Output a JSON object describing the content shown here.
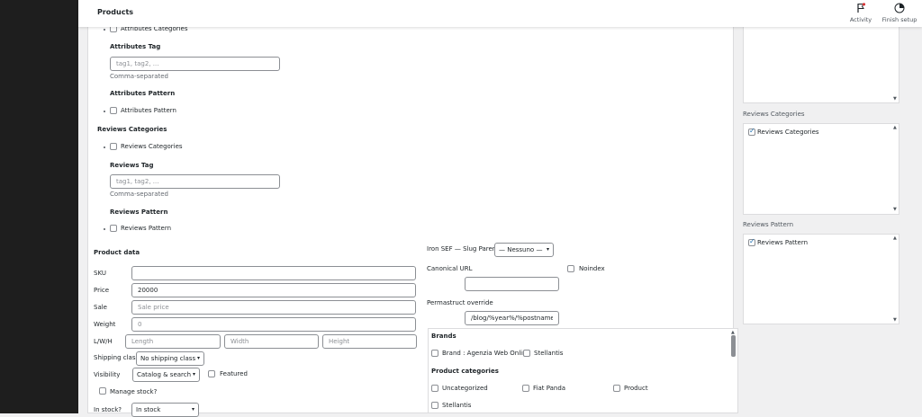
{
  "header": {
    "title": "Products",
    "activity_label": "Activity",
    "finish_setup_label": "Finish setup"
  },
  "left": {
    "attr_categories": "Attributes Categories",
    "attr_tag_title": "Attributes Tag",
    "attr_tag_placeholder": "tag1, tag2, ...",
    "attr_tag_hint": "Comma-separated",
    "attr_pattern_title": "Attributes Pattern",
    "attr_pattern_item": "Attributes Pattern",
    "rev_categories_title": "Reviews Categories",
    "rev_categories_item": "Reviews Categories",
    "rev_tag_title": "Reviews Tag",
    "rev_tag_placeholder": "tag1, tag2, ...",
    "rev_tag_hint": "Comma-separated",
    "rev_pattern_title": "Reviews Pattern",
    "rev_pattern_item": "Reviews Pattern"
  },
  "product_data": {
    "title": "Product data",
    "sku_label": "SKU",
    "sku_value": "",
    "price_label": "Price",
    "price_value": "20000",
    "sale_label": "Sale",
    "sale_placeholder": "Sale price",
    "weight_label": "Weight",
    "weight_placeholder": "0",
    "lwh_label": "L/W/H",
    "length_placeholder": "Length",
    "width_placeholder": "Width",
    "height_placeholder": "Height",
    "shipping_label": "Shipping class",
    "shipping_value": "No shipping class",
    "visibility_label": "Visibility",
    "visibility_value": "Catalog & search",
    "featured_label": "Featured",
    "manage_stock_label": "Manage stock?",
    "in_stock_label": "In stock?",
    "in_stock_value": "In stock"
  },
  "seo": {
    "slug_parent_label": "Iron SEF — Slug Parent",
    "slug_parent_value": "— Nessuno —",
    "canonical_label": "Canonical URL",
    "noindex_label": "Noindex",
    "permastruct_label": "Permastruct override",
    "permastruct_value": "/blog/%year%/%postname%"
  },
  "taxonomy": {
    "brands_title": "Brands",
    "brands": [
      "Brand : Agenzia Web Online",
      "Stellantis"
    ],
    "categories_title": "Product categories",
    "categories": [
      "Uncategorized",
      "Fiat Panda",
      "Product",
      "Stellantis"
    ]
  },
  "right": {
    "rev_categories_title": "Reviews Categories",
    "rev_categories_item": "Reviews Categories",
    "rev_pattern_title": "Reviews Pattern",
    "rev_pattern_item": "Reviews Pattern"
  }
}
